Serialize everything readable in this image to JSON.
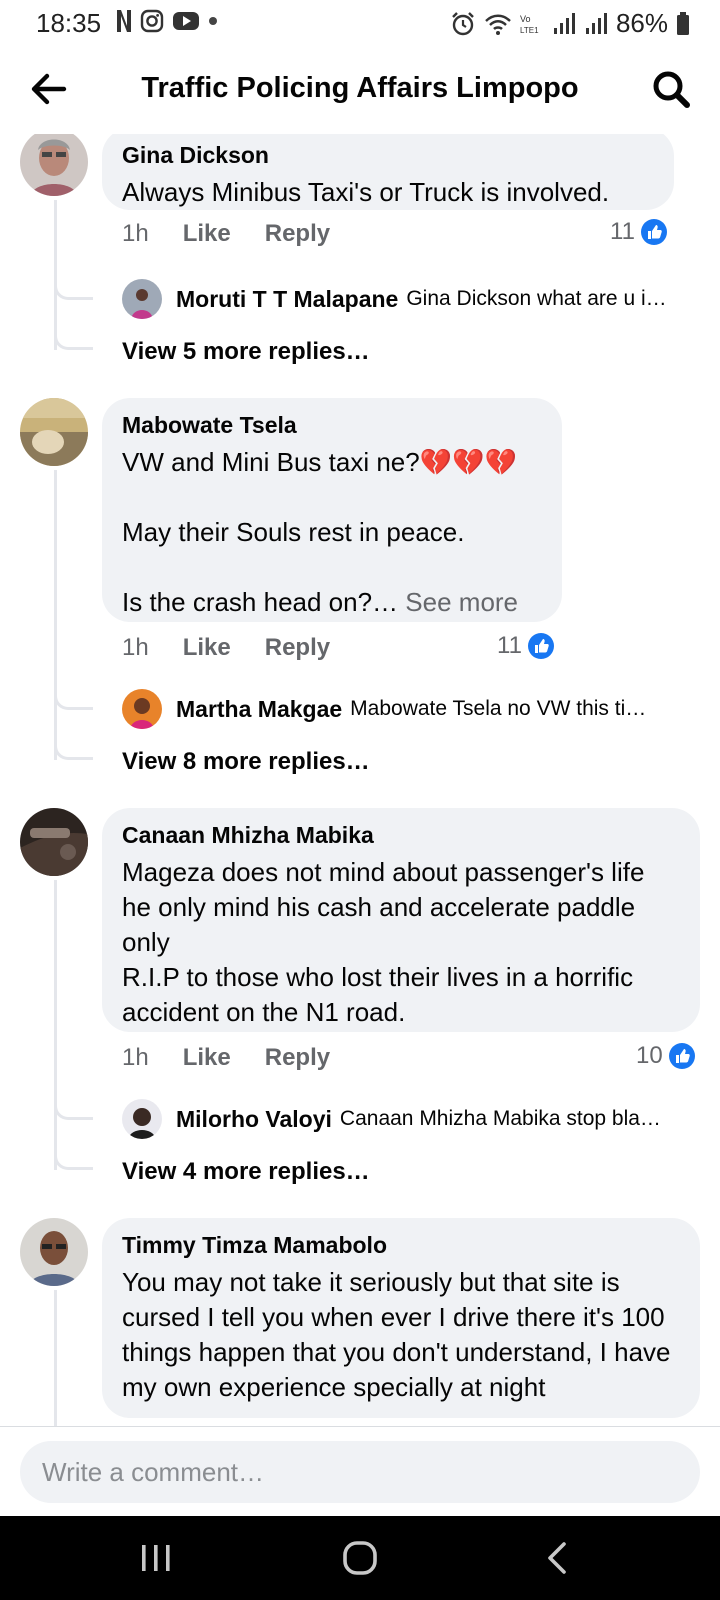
{
  "status_bar": {
    "time": "18:35",
    "battery": "86%",
    "icons": [
      "netflix-icon",
      "instagram-icon",
      "youtube-icon",
      "dot-icon",
      "alarm-icon",
      "wifi-icon",
      "volte-icon",
      "signal-icon",
      "battery-icon"
    ]
  },
  "header": {
    "title": "Traffic Policing Affairs Limpopo",
    "back_icon": "back-arrow-icon",
    "search_icon": "search-icon"
  },
  "comments": [
    {
      "author": "Gina Dickson",
      "text": "Always Minibus Taxi's or Truck is involved.",
      "time": "1h",
      "like_label": "Like",
      "reply_label": "Reply",
      "reactions": "11",
      "reply_preview": {
        "author": "Moruti T T Malapane",
        "text": "Gina Dickson what are u i…"
      },
      "view_more": "View 5 more replies…"
    },
    {
      "author": "Mabowate Tsela",
      "text": "VW and Mini Bus taxi ne?💔💔💔\n\nMay their Souls rest in peace.\n\nIs the crash head on?…",
      "see_more": "See more",
      "time": "1h",
      "like_label": "Like",
      "reply_label": "Reply",
      "reactions": "11",
      "reply_preview": {
        "author": "Martha Makgae",
        "text": "Mabowate Tsela no VW this ti…"
      },
      "view_more": "View 8 more replies…"
    },
    {
      "author": "Canaan Mhizha Mabika",
      "text": "Mageza does not mind about passenger's life he only mind his cash and accelerate paddle only\nR.I.P to those who lost their lives in a horrific accident on the N1 road.",
      "time": "1h",
      "like_label": "Like",
      "reply_label": "Reply",
      "reactions": "10",
      "reply_preview": {
        "author": "Milorho Valoyi",
        "text": "Canaan Mhizha Mabika stop bla…"
      },
      "view_more": "View 4 more replies…"
    },
    {
      "author": "Timmy Timza Mamabolo",
      "text": "You may not take it seriously but that site is cursed I tell you when ever I drive there it's 100 things happen that you don't understand, I have my own experience specially at night"
    }
  ],
  "composer": {
    "placeholder": "Write a comment…"
  },
  "nav": {
    "icons": [
      "recent-apps-icon",
      "home-icon",
      "nav-back-icon"
    ]
  },
  "colors": {
    "accent": "#1877f2",
    "bubble": "#f0f2f5",
    "secondary_text": "#65676b"
  }
}
